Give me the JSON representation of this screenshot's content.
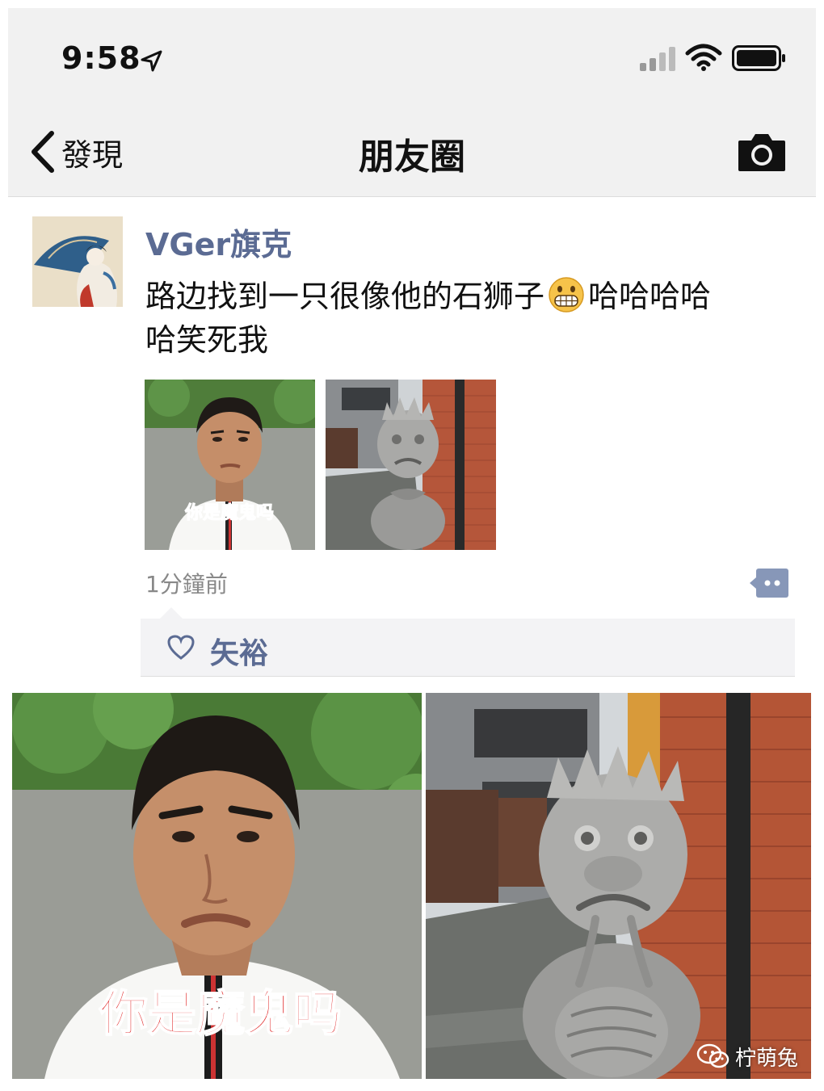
{
  "status_bar": {
    "time": "9:58"
  },
  "nav": {
    "back_label": "發現",
    "title": "朋友圈"
  },
  "post": {
    "author": "VGer旗克",
    "text_line1_before": "路边找到一只很像他的石狮子",
    "text_line1_after": "哈哈哈哈",
    "text_line2": "哈笑死我",
    "image_caption": "你是魔鬼吗",
    "time_ago": "1分鐘前",
    "likes": [
      "矢裕"
    ]
  },
  "watermark": {
    "text": "柠萌兔"
  },
  "icons": [
    "location-arrow-icon",
    "signal-icon",
    "wifi-icon",
    "battery-icon",
    "back-chevron-icon",
    "camera-icon",
    "grin-emoji-icon",
    "comment-icon",
    "heart-icon",
    "wechat-icon"
  ],
  "colors": {
    "link": "#5b6b93",
    "topbar_bg": "#f1f1f1",
    "likes_bg": "#f3f3f5",
    "caption": "#e02424"
  }
}
